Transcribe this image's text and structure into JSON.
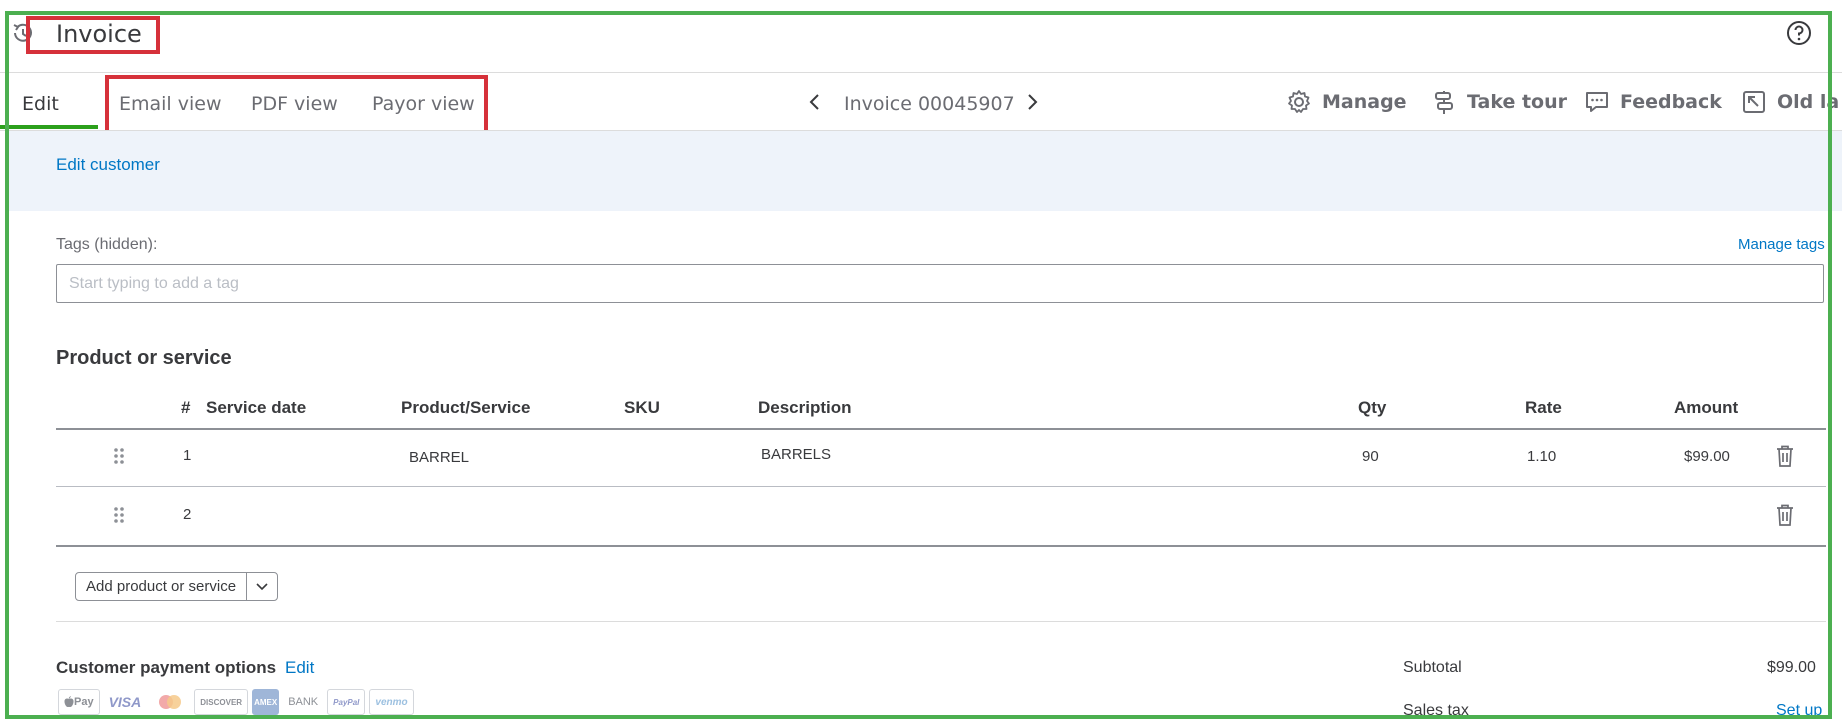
{
  "header": {
    "title": "Invoice",
    "history_icon": "history-icon",
    "help_icon": "help-icon"
  },
  "tabs": {
    "edit": "Edit",
    "email_view": "Email view",
    "pdf_view": "PDF view",
    "payor_view": "Payor view"
  },
  "invoice_nav": {
    "title": "Invoice 00045907",
    "prev_icon": "chevron-left-icon",
    "next_icon": "chevron-right-icon"
  },
  "toolbar": {
    "manage": "Manage",
    "take_tour": "Take tour",
    "feedback": "Feedback",
    "old_layout": "Old la"
  },
  "customer": {
    "edit_customer": "Edit customer"
  },
  "tags": {
    "label": "Tags (hidden):",
    "manage_tags": "Manage tags",
    "placeholder": "Start typing to add a tag",
    "value": ""
  },
  "products": {
    "title": "Product or service",
    "columns": {
      "num": "#",
      "service_date": "Service date",
      "product_service": "Product/Service",
      "sku": "SKU",
      "description": "Description",
      "qty": "Qty",
      "rate": "Rate",
      "amount": "Amount"
    },
    "rows": [
      {
        "num": "1",
        "service_date": "",
        "product": "BARREL",
        "sku": "",
        "description": "BARRELS",
        "qty": "90",
        "rate": "1.10",
        "amount": "$99.00"
      },
      {
        "num": "2",
        "service_date": "",
        "product": "",
        "sku": "",
        "description": "",
        "qty": "",
        "rate": "",
        "amount": ""
      }
    ],
    "add_button": "Add product or service"
  },
  "payment": {
    "title": "Customer payment options",
    "edit": "Edit",
    "methods": [
      "Pay",
      "VISA",
      "DISCOVER",
      "AMEX",
      "BANK",
      "PayPal",
      "venmo"
    ]
  },
  "totals": {
    "subtotal_label": "Subtotal",
    "subtotal_value": "$99.00",
    "sales_tax_label": "Sales tax",
    "sales_tax_action": "Set up"
  },
  "colors": {
    "highlight_red": "#d6313a",
    "highlight_green": "#4caf50",
    "link_blue": "#0077c5",
    "active_tab_green": "#2ca01c"
  }
}
